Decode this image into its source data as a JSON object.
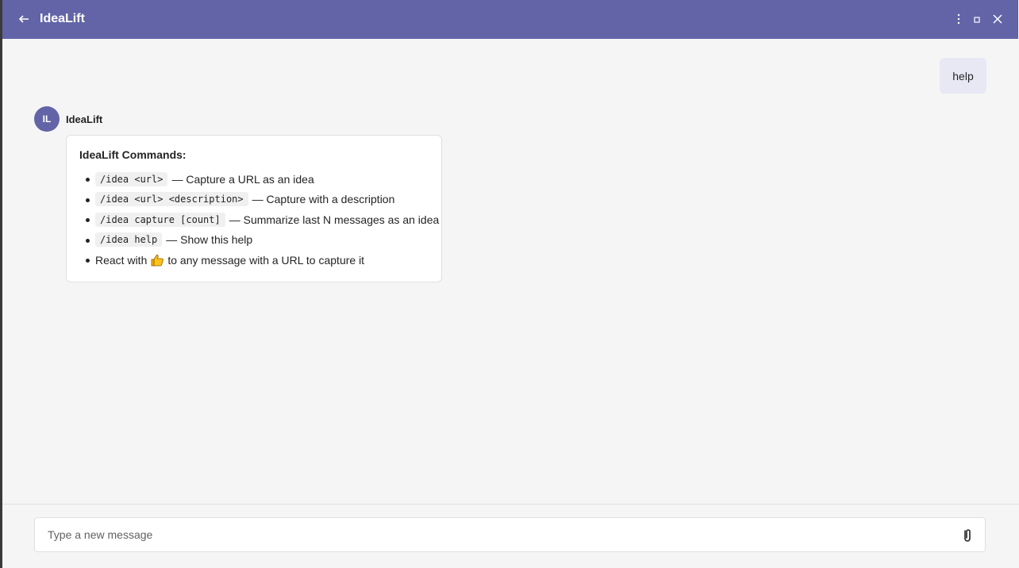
{
  "titlebar": {
    "title": "IdeaLift",
    "back_icon": "arrow-left-icon",
    "more_icon": "more-vertical-icon",
    "maximize_icon": "maximize-icon",
    "close_icon": "close-icon",
    "color": "#6264a7"
  },
  "messages": {
    "user": {
      "text": "help"
    },
    "bot": {
      "avatar_initials": "IL",
      "sender": "IdeaLift",
      "title": "IdeaLift Commands:",
      "items": [
        {
          "code": "/idea <url>",
          "text": "— Capture a URL as an idea"
        },
        {
          "code": "/idea <url> <description>",
          "text": "— Capture with a description"
        },
        {
          "code": "/idea capture [count]",
          "text": "— Summarize last N messages as an idea"
        },
        {
          "code": "/idea help",
          "text": "— Show this help"
        },
        {
          "pre": "React with",
          "emoji_icon": "thumbs-up-icon",
          "post": "to any message with a URL to capture it"
        }
      ]
    }
  },
  "composer": {
    "placeholder": "Type a new message",
    "attach_icon": "paperclip-icon"
  }
}
